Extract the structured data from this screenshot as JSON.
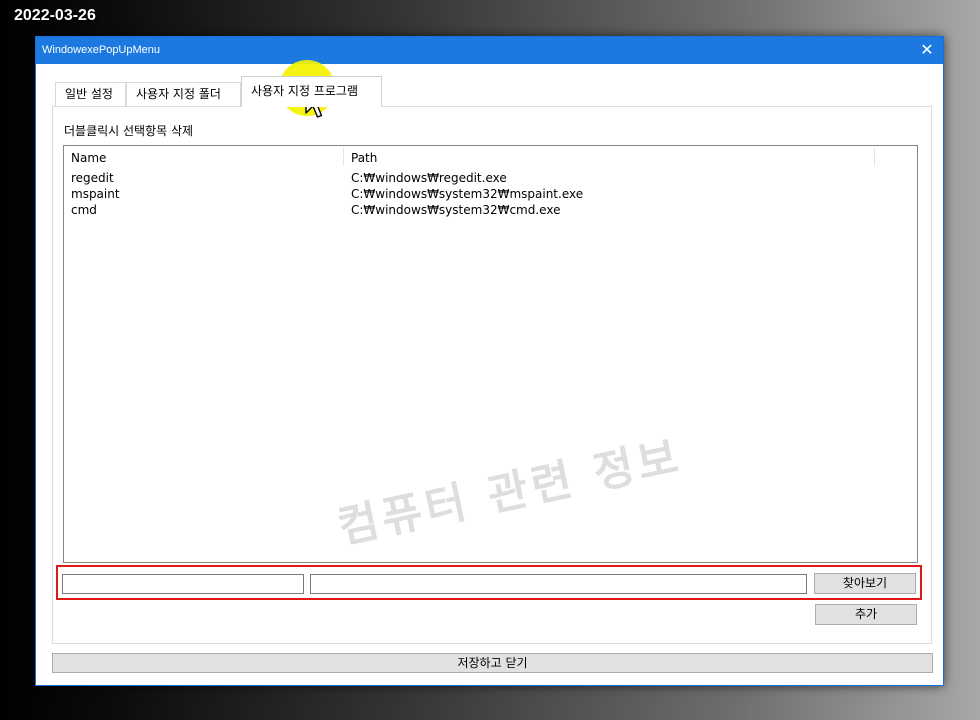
{
  "date_stamp": "2022-03-26",
  "window": {
    "title": "WindowexePopUpMenu",
    "close_glyph": "✕"
  },
  "tabs": [
    {
      "label": "일반 설정",
      "active": false
    },
    {
      "label": "사용자 지정 폴더",
      "active": false
    },
    {
      "label": "사용자 지정 프로그램",
      "active": true
    }
  ],
  "panel": {
    "hint": "더블클릭시 선택항목 삭제",
    "columns": [
      "Name",
      "Path"
    ],
    "rows": [
      {
        "name": "regedit",
        "path": "C:₩windows₩regedit.exe"
      },
      {
        "name": "mspaint",
        "path": "C:₩windows₩system32₩mspaint.exe"
      },
      {
        "name": "cmd",
        "path": "C:₩windows₩system32₩cmd.exe"
      }
    ],
    "watermark": "컴퓨터 관련 정보",
    "name_input": {
      "value": "",
      "placeholder": ""
    },
    "path_input": {
      "value": "",
      "placeholder": ""
    },
    "browse_label": "찾아보기",
    "add_label": "추가"
  },
  "save_close_label": "저장하고 닫기",
  "colors": {
    "titlebar": "#1b79e0",
    "highlight_box": "#e01818",
    "cursor_highlight": "#f4f200"
  },
  "icons": {
    "cursor": "arrow-cursor-icon",
    "close": "close-icon"
  }
}
